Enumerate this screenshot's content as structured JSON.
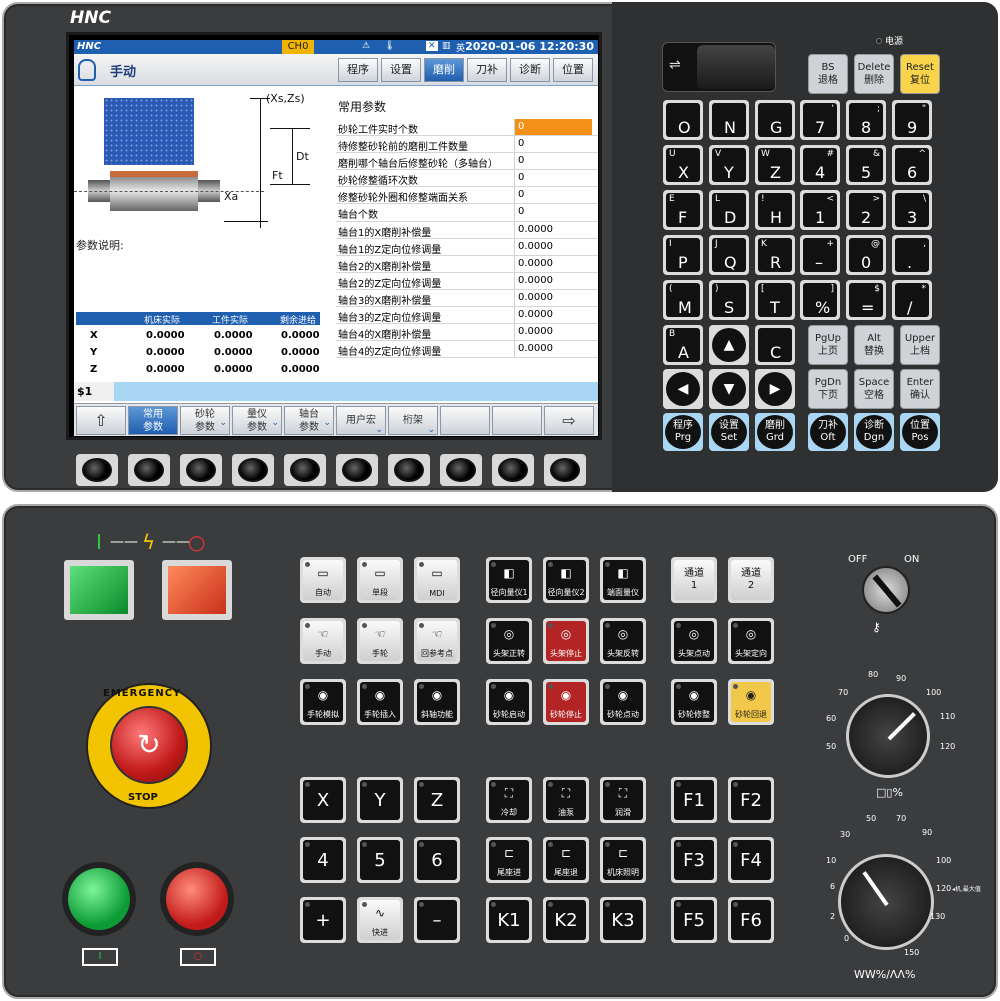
{
  "header": {
    "logo": "HNC",
    "channel": "CH0",
    "lang": "英",
    "datetime": "2020-01-06 12:20:30",
    "power_label": "电源"
  },
  "mode": {
    "label": "手动"
  },
  "tabs": [
    {
      "label": "程序"
    },
    {
      "label": "设置"
    },
    {
      "label": "磨削"
    },
    {
      "label": "刀补"
    },
    {
      "label": "诊断"
    },
    {
      "label": "位置"
    }
  ],
  "figure": {
    "xs_zs": "(Xs,Zs)",
    "dt": "Dt",
    "ft": "Ft",
    "xa": "Xa"
  },
  "params": {
    "title": "常用参数",
    "desc_label": "参数说明:",
    "rows": [
      {
        "name": "砂轮工件实时个数",
        "value": "0"
      },
      {
        "name": "待修整砂轮前的磨削工件数量",
        "value": "0"
      },
      {
        "name": "磨削哪个轴台后修整砂轮（多轴台）",
        "value": "0"
      },
      {
        "name": "砂轮修整循环次数",
        "value": "0"
      },
      {
        "name": "修整砂轮外圈和修整端面关系",
        "value": "0"
      },
      {
        "name": "轴台个数",
        "value": "0"
      },
      {
        "name": "轴台1的X磨削补偿量",
        "value": "0.0000"
      },
      {
        "name": "轴台1的Z定向位修调量",
        "value": "0.0000"
      },
      {
        "name": "轴台2的X磨削补偿量",
        "value": "0.0000"
      },
      {
        "name": "轴台2的Z定向位修调量",
        "value": "0.0000"
      },
      {
        "name": "轴台3的X磨削补偿量",
        "value": "0.0000"
      },
      {
        "name": "轴台3的Z定向位修调量",
        "value": "0.0000"
      },
      {
        "name": "轴台4的X磨削补偿量",
        "value": "0.0000"
      },
      {
        "name": "轴台4的Z定向位修调量",
        "value": "0.0000"
      }
    ]
  },
  "coords": {
    "headers": [
      "机床实际",
      "工件实际",
      "剩余进给"
    ],
    "rows": [
      {
        "axis": "X",
        "a": "0.0000",
        "b": "0.0000",
        "c": "0.0000"
      },
      {
        "axis": "Y",
        "a": "0.0000",
        "b": "0.0000",
        "c": "0.0000"
      },
      {
        "axis": "Z",
        "a": "0.0000",
        "b": "0.0000",
        "c": "0.0000"
      }
    ]
  },
  "cmdline": {
    "label": "$1"
  },
  "fkeys": [
    {
      "l1": "常用",
      "l2": "参数"
    },
    {
      "l1": "砂轮",
      "l2": "参数"
    },
    {
      "l1": "量仪",
      "l2": "参数"
    },
    {
      "l1": "轴台",
      "l2": "参数"
    },
    {
      "l1": "用户宏",
      "l2": ""
    },
    {
      "l1": "桁架",
      "l2": ""
    }
  ],
  "keypad": {
    "bs": [
      "BS",
      "退格"
    ],
    "delete": [
      "Delete",
      "删除"
    ],
    "reset": [
      "Reset",
      "复位"
    ],
    "rows": [
      [
        {
          "b": "O",
          "s": ""
        },
        {
          "b": "N",
          "s": ""
        },
        {
          "b": "G",
          "s": ""
        },
        {
          "b": "7",
          "s": "'"
        },
        {
          "b": "8",
          "s": ";"
        },
        {
          "b": "9",
          "s": "\""
        }
      ],
      [
        {
          "b": "X",
          "s": "U"
        },
        {
          "b": "Y",
          "s": "V"
        },
        {
          "b": "Z",
          "s": "W"
        },
        {
          "b": "4",
          "s": "#"
        },
        {
          "b": "5",
          "s": "&"
        },
        {
          "b": "6",
          "s": "^"
        }
      ],
      [
        {
          "b": "F",
          "s": "E"
        },
        {
          "b": "D",
          "s": "L"
        },
        {
          "b": "H",
          "s": "!"
        },
        {
          "b": "1",
          "s": "<"
        },
        {
          "b": "2",
          "s": ">"
        },
        {
          "b": "3",
          "s": "\\"
        }
      ],
      [
        {
          "b": "P",
          "s": "I"
        },
        {
          "b": "Q",
          "s": "J"
        },
        {
          "b": "R",
          "s": "K"
        },
        {
          "b": "–",
          "s": "+"
        },
        {
          "b": "0",
          "s": "@"
        },
        {
          "b": ".",
          "s": ","
        }
      ],
      [
        {
          "b": "M",
          "s": "("
        },
        {
          "b": "S",
          "s": ")"
        },
        {
          "b": "T",
          "s": "["
        },
        {
          "b": "%",
          "s": "]"
        },
        {
          "b": "=",
          "s": "$"
        },
        {
          "b": "/",
          "s": "*"
        }
      ]
    ],
    "row6": [
      {
        "b": "A",
        "s": "B"
      },
      {
        "b": "C",
        "s": ""
      }
    ],
    "pgup": [
      "PgUp",
      "上页"
    ],
    "alt": [
      "Alt",
      "替换"
    ],
    "upper": [
      "Upper",
      "上档"
    ],
    "pgdn": [
      "PgDn",
      "下页"
    ],
    "space": [
      "Space",
      "空格"
    ],
    "enter": [
      "Enter",
      "确认"
    ],
    "funcs": [
      [
        "程序",
        "Prg"
      ],
      [
        "设置",
        "Set"
      ],
      [
        "磨削",
        "Grd"
      ],
      [
        "刀补",
        "Oft"
      ],
      [
        "诊断",
        "Dgn"
      ],
      [
        "位置",
        "Pos"
      ]
    ]
  },
  "machine": {
    "row1": [
      "自动",
      "单段",
      "MDI",
      "径向量仪1",
      "径向量仪2",
      "端面量仪"
    ],
    "row2": [
      "手动",
      "手轮",
      "回参考点",
      "头架正转",
      "头架停止",
      "头架反转",
      "头架点动",
      "头架定向"
    ],
    "row3": [
      "手轮模拟",
      "手轮插入",
      "斜轴功能",
      "砂轮启动",
      "砂轮停止",
      "砂轮点动",
      "砂轮修整",
      "砂轮回退"
    ],
    "channels": [
      [
        "通道",
        "1"
      ],
      [
        "通道",
        "2"
      ]
    ],
    "axes1": [
      "X",
      "Y",
      "Z"
    ],
    "cool": [
      "冷却",
      "油泵",
      "润滑"
    ],
    "f1": [
      "F1",
      "F2"
    ],
    "axes2": [
      "4",
      "5",
      "6"
    ],
    "tail": [
      "尾座进",
      "尾座退",
      "机床照明"
    ],
    "f2": [
      "F3",
      "F4"
    ],
    "axes3": [
      "+",
      "快进",
      "–"
    ],
    "kk": [
      "K1",
      "K2",
      "K3"
    ],
    "f3": [
      "F5",
      "F6"
    ],
    "estop_top": "EMERGENCY",
    "estop_bot": "STOP",
    "keyswitch": {
      "off": "OFF",
      "on": "ON"
    },
    "spindle_scale": [
      "50",
      "60",
      "70",
      "80",
      "90",
      "100",
      "110",
      "120"
    ],
    "feed_scale": [
      "0",
      "2",
      "6",
      "10",
      "30",
      "50",
      "70",
      "90",
      "100",
      "120",
      "130",
      "150"
    ],
    "feed_note": "◂机,最大值",
    "spindle_label": "□▯%",
    "feed_label": "WW%/ΛΛ%"
  }
}
